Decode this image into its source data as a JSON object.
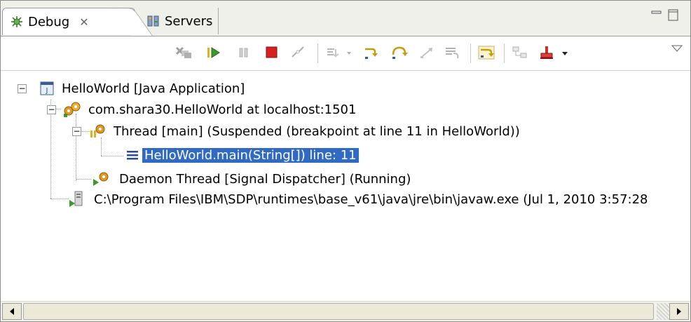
{
  "tabs": [
    {
      "label": "Debug",
      "icon": "debug-icon",
      "close": "✕"
    },
    {
      "label": "Servers",
      "icon": "servers-icon"
    }
  ],
  "toolbar": {
    "buttons": [
      "remove-terminated-icon",
      "resume-icon",
      "suspend-icon",
      "terminate-icon",
      "disconnect-icon",
      "step-into-selection-icon",
      "dropdown-icon",
      "step-into-icon",
      "step-over-icon",
      "step-return-icon",
      "drop-to-frame-icon",
      "use-step-filters-icon",
      "collapse-all-icon",
      "stop-icon",
      "view-menu-icon"
    ]
  },
  "tree": {
    "app": "HelloWorld [Java Application]",
    "vm": "com.shara30.HelloWorld at localhost:1501",
    "thread_main": "Thread [main] (Suspended (breakpoint at line 11 in HelloWorld))",
    "frame": "HelloWorld.main(String[]) line: 11",
    "daemon": "Daemon Thread [Signal Dispatcher] (Running)",
    "process": "C:\\Program Files\\IBM\\SDP\\runtimes\\base_v61\\java\\jre\\bin\\javaw.exe (Jul 1, 2010 3:57:28"
  },
  "colors": {
    "selection": "#316ac5",
    "terminate": "#d42020",
    "resume": "#3a9a2a",
    "step": "#c89a10"
  }
}
